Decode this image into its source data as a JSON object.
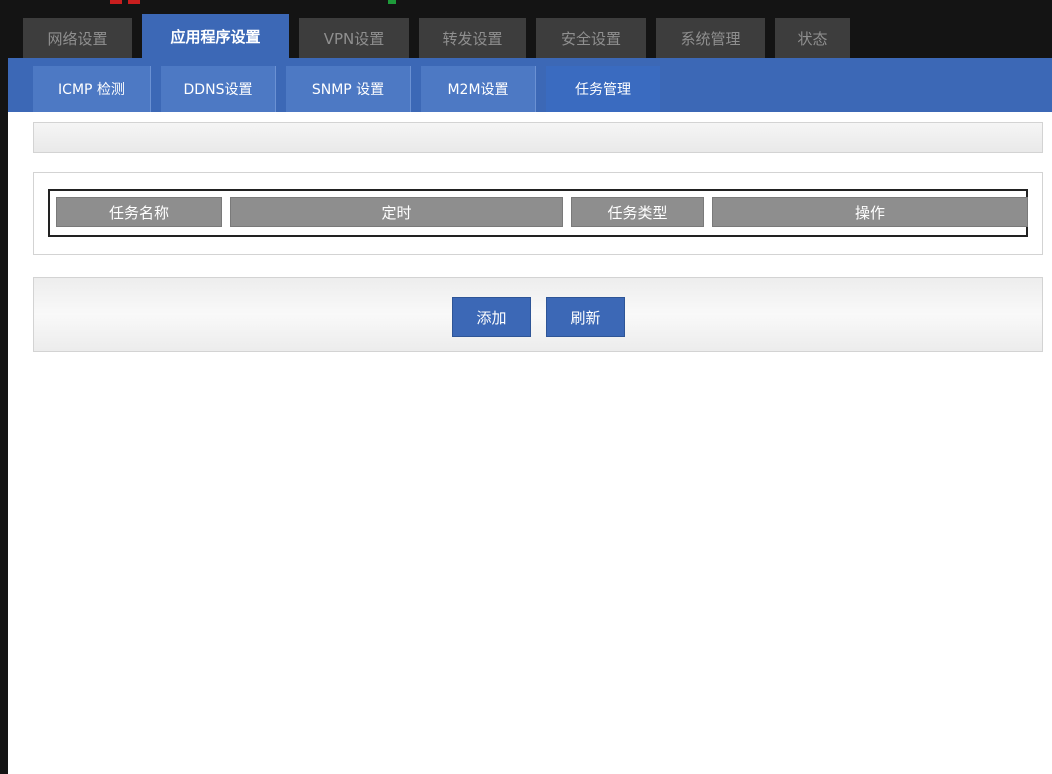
{
  "nav": {
    "main_tabs": [
      {
        "label": "网络设置"
      },
      {
        "label": "应用程序设置"
      },
      {
        "label": "VPN设置"
      },
      {
        "label": "转发设置"
      },
      {
        "label": "安全设置"
      },
      {
        "label": "系统管理"
      },
      {
        "label": "状态"
      }
    ],
    "active_main_tab": "应用程序设置",
    "sub_tabs": [
      {
        "label": "ICMP 检测"
      },
      {
        "label": "DDNS设置"
      },
      {
        "label": "SNMP 设置"
      },
      {
        "label": "M2M设置"
      },
      {
        "label": "任务管理"
      }
    ],
    "active_sub_tab": "任务管理"
  },
  "task_table": {
    "columns": [
      "任务名称",
      "定时",
      "任务类型",
      "操作"
    ],
    "rows": []
  },
  "actions": {
    "add_label": "添加",
    "refresh_label": "刷新"
  },
  "colors": {
    "accent": "#3c68b6",
    "topbar": "#141414",
    "inactive_tab": "#3d3d3d",
    "table_header": "#8e8e8e"
  }
}
